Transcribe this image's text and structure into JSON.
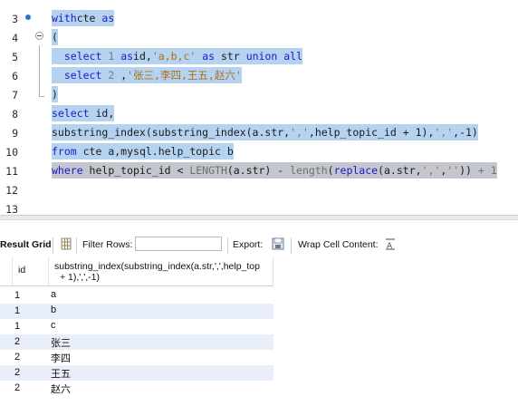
{
  "editor": {
    "lines": [
      {
        "num": "3",
        "tokens": [
          [
            "kw",
            "with"
          ],
          [
            "",
            "cte"
          ],
          [
            "kw",
            " as"
          ]
        ]
      },
      {
        "num": "4",
        "tokens": [
          [
            "",
            "("
          ]
        ]
      },
      {
        "num": "5",
        "tokens": [
          [
            "",
            "  "
          ],
          [
            "kw",
            "select"
          ],
          [
            "num",
            " 1 "
          ],
          [
            "kw",
            "as"
          ],
          [
            "",
            "id,"
          ],
          [
            "str",
            "'a,b,c'"
          ],
          [
            "kw",
            " as"
          ],
          [
            "",
            " str "
          ],
          [
            "kw",
            "union all"
          ]
        ]
      },
      {
        "num": "6",
        "tokens": [
          [
            "",
            "  "
          ],
          [
            "kw",
            "select"
          ],
          [
            "num",
            " 2 "
          ],
          [
            "",
            ","
          ],
          [
            "str",
            "'张三,李四,王五,赵六'"
          ]
        ]
      },
      {
        "num": "7",
        "tokens": [
          [
            "",
            ")"
          ]
        ]
      },
      {
        "num": "8",
        "tokens": [
          [
            "kw",
            "select"
          ],
          [
            "",
            " id,"
          ]
        ]
      },
      {
        "num": "9",
        "tokens": [
          [
            "",
            "substring_index(substring_index(a.str,"
          ],
          [
            "str",
            "','"
          ],
          [
            "",
            ",help_topic_id + 1),"
          ],
          [
            "str",
            "','"
          ],
          [
            "",
            ",-1)"
          ]
        ]
      },
      {
        "num": "10",
        "tokens": [
          [
            "kw",
            "from"
          ],
          [
            "",
            " cte a,mysql.help_topic b"
          ]
        ]
      },
      {
        "num": "11",
        "tokens": [
          [
            "kw",
            "where"
          ],
          [
            "",
            " help_topic_id < "
          ],
          [
            "op",
            "LENGTH"
          ],
          [
            "",
            "(a.str) - "
          ],
          [
            "op",
            "length"
          ],
          [
            "",
            "("
          ],
          [
            "fn",
            "replace"
          ],
          [
            "",
            "(a.str,"
          ],
          [
            "str",
            "','"
          ],
          [
            "",
            ","
          ],
          [
            "str",
            "''"
          ],
          [
            "",
            "))"
          ],
          [
            "op",
            " + 1"
          ]
        ]
      },
      {
        "num": "12",
        "tokens": []
      },
      {
        "num": "13",
        "tokens": []
      }
    ]
  },
  "toolbar": {
    "result_grid_label": "Result Grid",
    "filter_rows_label": "Filter Rows:",
    "filter_rows_value": "",
    "export_label": "Export:",
    "wrap_cell_label": "Wrap Cell Content:",
    "wrap_icon": "wrap-text-icon",
    "grid_icon": "grid-icon",
    "export_icon": "export-icon"
  },
  "grid": {
    "columns": [
      "id",
      "substring_index(substring_index(a.str,',',help_top",
      "+ 1),',',-1)"
    ],
    "rows": [
      {
        "id": "1",
        "value": "a"
      },
      {
        "id": "1",
        "value": "b"
      },
      {
        "id": "1",
        "value": "c"
      },
      {
        "id": "2",
        "value": "张三"
      },
      {
        "id": "2",
        "value": "李四"
      },
      {
        "id": "2",
        "value": "王五"
      },
      {
        "id": "2",
        "value": "赵六"
      }
    ]
  },
  "colors": {
    "selection": "#b5d3f1",
    "keyword": "#1a1ac8",
    "string": "#a6701c",
    "alt_row": "#e8eefa"
  }
}
